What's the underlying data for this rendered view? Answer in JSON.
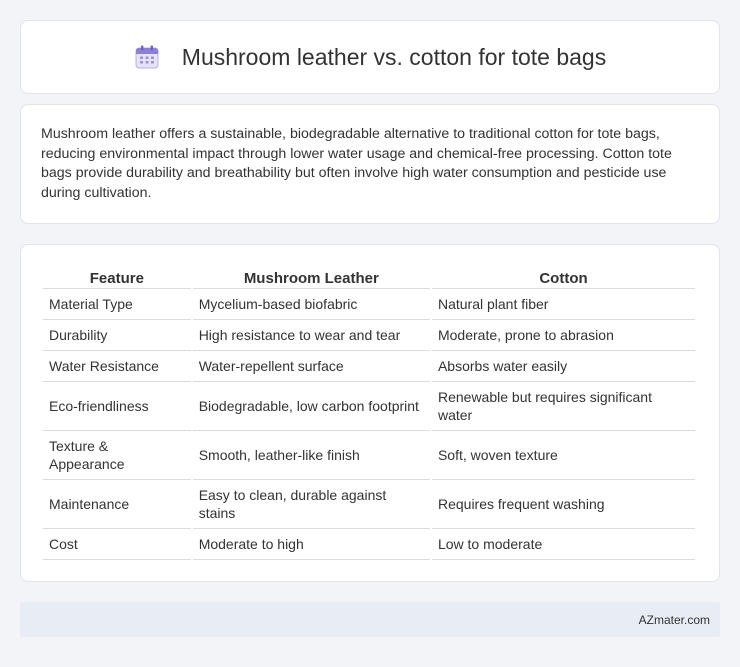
{
  "header": {
    "icon": "calendar-icon",
    "title": "Mushroom leather vs. cotton for tote bags"
  },
  "description": "Mushroom leather offers a sustainable, biodegradable alternative to traditional cotton for tote bags, reducing environmental impact through lower water usage and chemical-free processing. Cotton tote bags provide durability and breathability but often involve high water consumption and pesticide use during cultivation.",
  "table": {
    "headers": [
      "Feature",
      "Mushroom Leather",
      "Cotton"
    ],
    "rows": [
      [
        "Material Type",
        "Mycelium-based biofabric",
        "Natural plant fiber"
      ],
      [
        "Durability",
        "High resistance to wear and tear",
        "Moderate, prone to abrasion"
      ],
      [
        "Water Resistance",
        "Water-repellent surface",
        "Absorbs water easily"
      ],
      [
        "Eco-friendliness",
        "Biodegradable, low carbon footprint",
        "Renewable but requires significant water"
      ],
      [
        "Texture & Appearance",
        "Smooth, leather-like finish",
        "Soft, woven texture"
      ],
      [
        "Maintenance",
        "Easy to clean, durable against stains",
        "Requires frequent washing"
      ],
      [
        "Cost",
        "Moderate to high",
        "Low to moderate"
      ]
    ]
  },
  "footer": {
    "brand": "AZmater.com"
  },
  "colors": {
    "background": "#f3f4f8",
    "card": "#ffffff",
    "footer": "#e8ecf5",
    "icon_accent": "#8b7fd6"
  }
}
